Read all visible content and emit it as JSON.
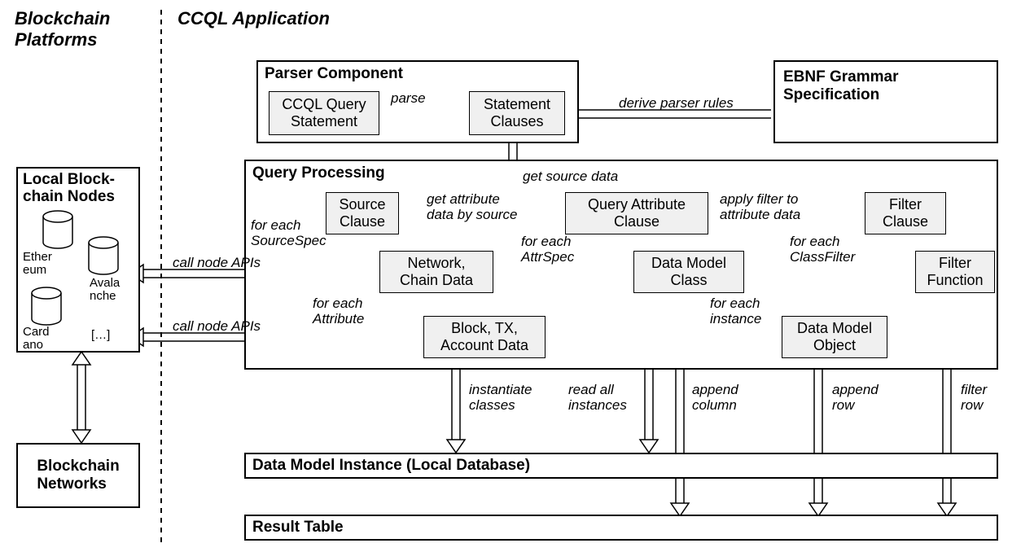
{
  "sections": {
    "blockchain_platforms": "Blockchain Platforms",
    "ccql_application": "CCQL Application"
  },
  "left": {
    "local_nodes_title": "Local Block-\nchain Nodes",
    "nodes": {
      "ethereum": "Ether\neum",
      "avalanche": "Avala\nnche",
      "cardano": "Card\nano",
      "more": "[…]"
    },
    "blockchain_networks": "Blockchain\nNetworks"
  },
  "right": {
    "parser_title": "Parser Component",
    "parser": {
      "ccql_query": "CCQL Query\nStatement",
      "statement_clauses": "Statement\nClauses"
    },
    "ebnf_title": "EBNF Grammar\nSpecification",
    "qp_title": "Query Processing",
    "qp": {
      "source_clause": "Source\nClause",
      "network_chain": "Network,\nChain Data",
      "block_tx": "Block, TX,\nAccount Data",
      "query_attr": "Query Attribute\nClause",
      "dm_class": "Data Model\nClass",
      "dm_object": "Data Model\nObject",
      "filter_clause": "Filter\nClause",
      "filter_function": "Filter\nFunction"
    },
    "dmi_title": "Data Model Instance (Local Database)",
    "result_title": "Result Table"
  },
  "edges": {
    "parse": "parse",
    "derive": "derive parser rules",
    "get_source_data": "get source data",
    "get_attr_by_source": "get attribute\ndata by source",
    "apply_filter": "apply filter to\nattribute data",
    "for_each_sourcespec": "for each\nSourceSpec",
    "for_each_attribute": "for each\nAttribute",
    "for_each_attrspec": "for each\nAttrSpec",
    "for_each_instance": "for each\ninstance",
    "for_each_classfilter": "for each\nClassFilter",
    "call_node_apis": "call node APIs",
    "instantiate_classes": "instantiate\nclasses",
    "read_all_instances": "read all\ninstances",
    "append_column": "append\ncolumn",
    "append_row": "append\nrow",
    "filter_row": "filter\nrow"
  }
}
